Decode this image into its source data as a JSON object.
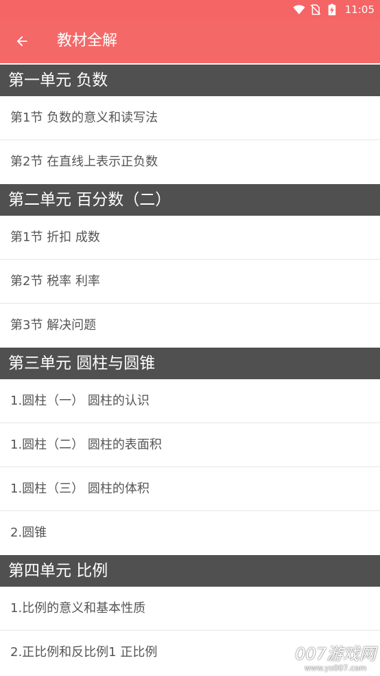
{
  "status_bar": {
    "time": "11:05",
    "icons": [
      "wifi-icon",
      "no-sim-icon",
      "battery-charging-icon"
    ],
    "color": "#f56565"
  },
  "toolbar": {
    "title": "教材全解",
    "back_icon": "arrow-left-icon",
    "color": "#f56868"
  },
  "sections": [
    {
      "title": "第一单元 负数",
      "items": [
        "第1节 负数的意义和读写法",
        "第2节 在直线上表示正负数"
      ]
    },
    {
      "title": "第二单元 百分数（二）",
      "items": [
        "第1节 折扣 成数",
        "第2节 税率 利率",
        "第3节 解决问题"
      ]
    },
    {
      "title": "第三单元 圆柱与圆锥",
      "items": [
        "1.圆柱（一） 圆柱的认识",
        "1.圆柱（二） 圆柱的表面积",
        "1.圆柱（三） 圆柱的体积",
        "2.圆锥"
      ]
    },
    {
      "title": "第四单元 比例",
      "items": [
        "1.比例的意义和基本性质",
        "2.正比例和反比例1 正比例"
      ]
    }
  ],
  "watermark": {
    "main": "007游戏网",
    "url": "www.yx007.com"
  }
}
